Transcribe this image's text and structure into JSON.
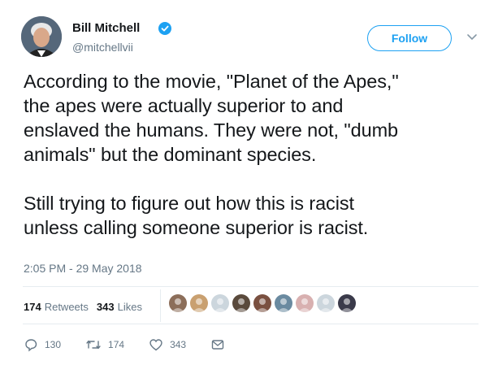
{
  "author": {
    "name": "Bill Mitchell",
    "handle": "@mitchellvii",
    "verified": true
  },
  "follow_button": {
    "label": "Follow"
  },
  "tweet": {
    "paragraphs": [
      "According to the movie, \"Planet of the Apes,\"\nthe apes were actually superior to and\nenslaved the humans.  They were not, \"dumb\nanimals\" but the dominant species.",
      "Still trying to figure out how this is racist\nunless calling someone superior is racist."
    ],
    "timestamp": "2:05 PM - 29 May 2018"
  },
  "stats": {
    "retweets_count": "174",
    "retweets_label": "Retweets",
    "likes_count": "343",
    "likes_label": "Likes"
  },
  "likers": [
    {
      "color": "#8c6e5a"
    },
    {
      "color": "#c9a070"
    },
    {
      "color": "#ccd6dd"
    },
    {
      "color": "#5a4a3c"
    },
    {
      "color": "#7a5040"
    },
    {
      "color": "#6a8aa0"
    },
    {
      "color": "#d8b0b0"
    },
    {
      "color": "#ccd6dd"
    },
    {
      "color": "#3a3a4a"
    }
  ],
  "actions": {
    "replies": "130",
    "retweets": "174",
    "likes": "343"
  },
  "colors": {
    "accent": "#1da1f2",
    "secondary_text": "#657786",
    "text": "#14171a"
  },
  "icons": {
    "verified": "verified-badge-icon",
    "caret": "chevron-down-icon",
    "reply": "reply-icon",
    "retweet": "retweet-icon",
    "like": "heart-icon",
    "dm": "envelope-icon"
  }
}
